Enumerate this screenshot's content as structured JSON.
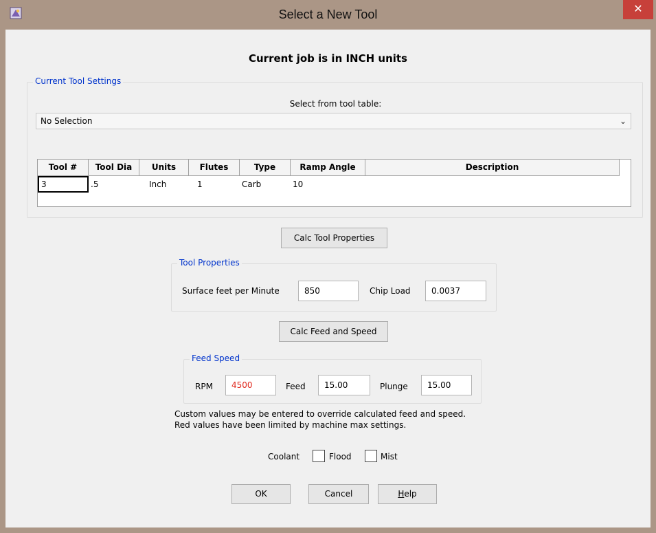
{
  "window": {
    "title": "Select a New Tool",
    "close_glyph": "✕",
    "icon": "app-icon"
  },
  "heading": "Current job is in INCH units",
  "current_tool_settings": {
    "legend": "Current Tool Settings",
    "select_label": "Select from tool table:",
    "selected": "No Selection",
    "dropdown_glyph": "⌄"
  },
  "tool_table": {
    "columns": [
      "Tool #",
      "Tool Dia",
      "Units",
      "Flutes",
      "Type",
      "Ramp Angle",
      "Description"
    ],
    "rows": [
      [
        "3",
        ".5",
        "Inch",
        "1",
        "Carb",
        "10",
        ""
      ]
    ]
  },
  "calc_tool_button": "Calc Tool Properties",
  "tool_properties": {
    "legend": "Tool Properties",
    "sfm_label": "Surface feet per Minute",
    "sfm_value": "850",
    "chip_label": "Chip Load",
    "chip_value": "0.0037"
  },
  "calc_feed_button": "Calc Feed and Speed",
  "feed_speed": {
    "legend": "Feed Speed",
    "rpm_label": "RPM",
    "rpm_value": "4500",
    "feed_label": "Feed",
    "feed_value": "15.00",
    "plunge_label": "Plunge",
    "plunge_value": "15.00"
  },
  "notes": [
    "Custom values may be entered to override calculated feed and speed.",
    "Red values have been limited by machine max settings."
  ],
  "coolant": {
    "label": "Coolant",
    "flood_label": "Flood",
    "flood_checked": false,
    "mist_label": "Mist",
    "mist_checked": false
  },
  "buttons": {
    "ok": "OK",
    "cancel": "Cancel",
    "help_first": "H",
    "help_rest": "elp"
  },
  "colors": {
    "titlebar": "#ab9686",
    "close": "#c7403a",
    "legend": "#0033cc",
    "limited_value": "#e0261b"
  }
}
